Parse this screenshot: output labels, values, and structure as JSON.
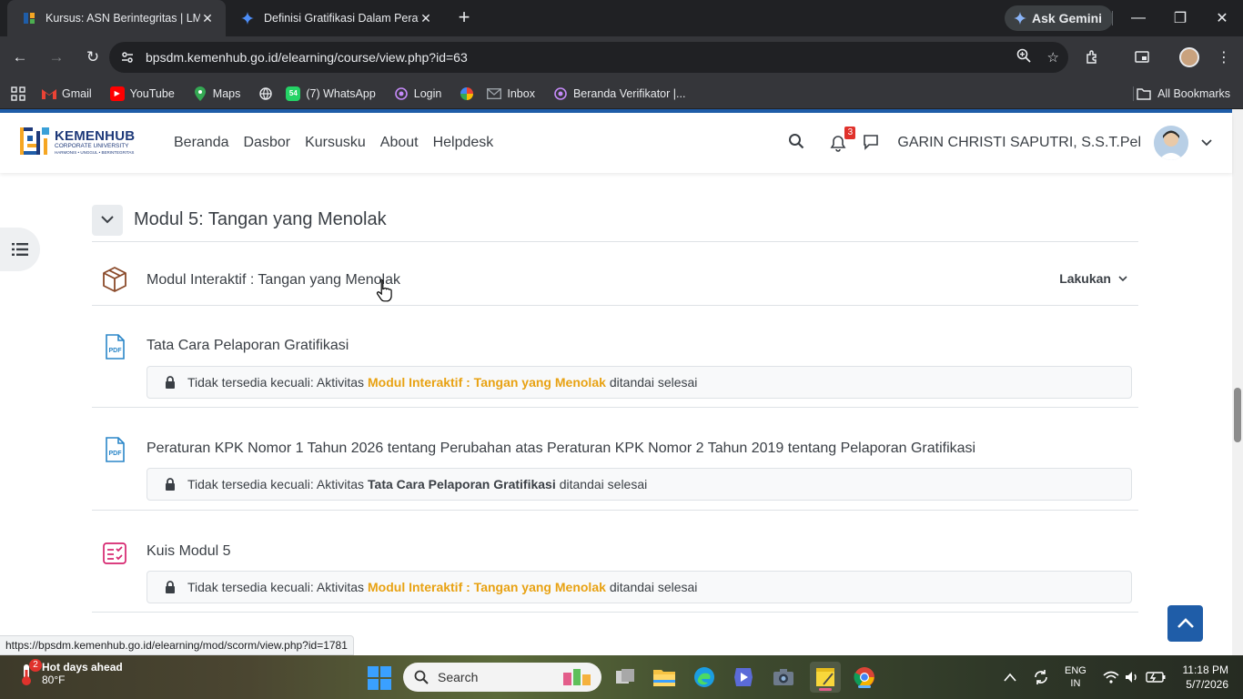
{
  "browser": {
    "tabs": [
      {
        "title": "Kursus: ASN Berintegritas | LMS",
        "active": true
      },
      {
        "title": "Definisi Gratifikasi Dalam Peratu",
        "active": false
      }
    ],
    "ask_gemini": "Ask Gemini",
    "url": "bpsdm.kemenhub.go.id/elearning/course/view.php?id=63",
    "bookmarks": [
      "Gmail",
      "YouTube",
      "Maps",
      "(7) WhatsApp",
      "Login",
      "Inbox",
      "Beranda Verifikator |..."
    ],
    "whatsapp_count": "54",
    "all_bookmarks": "All Bookmarks",
    "status_url": "https://bpsdm.kemenhub.go.id/elearning/mod/scorm/view.php?id=1781"
  },
  "site": {
    "logo_main": "KEMENHUB",
    "logo_sub": "CORPORATE UNIVERSITY",
    "logo_tag": "HARMONIS • UNGGUL • BERINTEGRITAS",
    "nav": [
      "Beranda",
      "Dasbor",
      "Kursusku",
      "About",
      "Helpdesk"
    ],
    "notif_count": "3",
    "user_name": "GARIN CHRISTI SAPUTRI, S.S.T.Pel"
  },
  "section": {
    "title": "Modul 5: Tangan yang Menolak",
    "activities": [
      {
        "name": "Modul Interaktif : Tangan yang Menolak",
        "type": "scorm",
        "action": "Lakukan"
      },
      {
        "name": "Tata Cara Pelaporan Gratifikasi",
        "type": "pdf",
        "restriction": {
          "prefix": "Tidak tersedia kecuali: Aktivitas",
          "activity": "Modul Interaktif : Tangan yang Menolak",
          "suffix": "ditandai selesai"
        }
      },
      {
        "name": "Peraturan KPK Nomor 1 Tahun 2026 tentang Perubahan atas Peraturan KPK Nomor 2 Tahun 2019 tentang Pelaporan Gratifikasi",
        "type": "pdf",
        "restriction": {
          "prefix": "Tidak tersedia kecuali: Aktivitas",
          "activity": "Tata Cara Pelaporan Gratifikasi",
          "suffix": "ditandai selesai"
        }
      },
      {
        "name": "Kuis Modul 5",
        "type": "quiz",
        "restriction": {
          "prefix": "Tidak tersedia kecuali: Aktivitas",
          "activity": "Modul Interaktif : Tangan yang Menolak",
          "suffix": "ditandai selesai"
        }
      }
    ]
  },
  "taskbar": {
    "weather_badge": "2",
    "weather_title": "Hot days ahead",
    "weather_temp": "80°F",
    "search_placeholder": "Search",
    "lang_top": "ENG",
    "lang_bottom": "IN",
    "time": "11:18 PM",
    "date": "5/7/2026"
  },
  "colors": {
    "brand_blue": "#1f5da8",
    "restriction_link": "#e8a213",
    "chrome_dark": "#202124",
    "chrome_mid": "#35363a"
  }
}
